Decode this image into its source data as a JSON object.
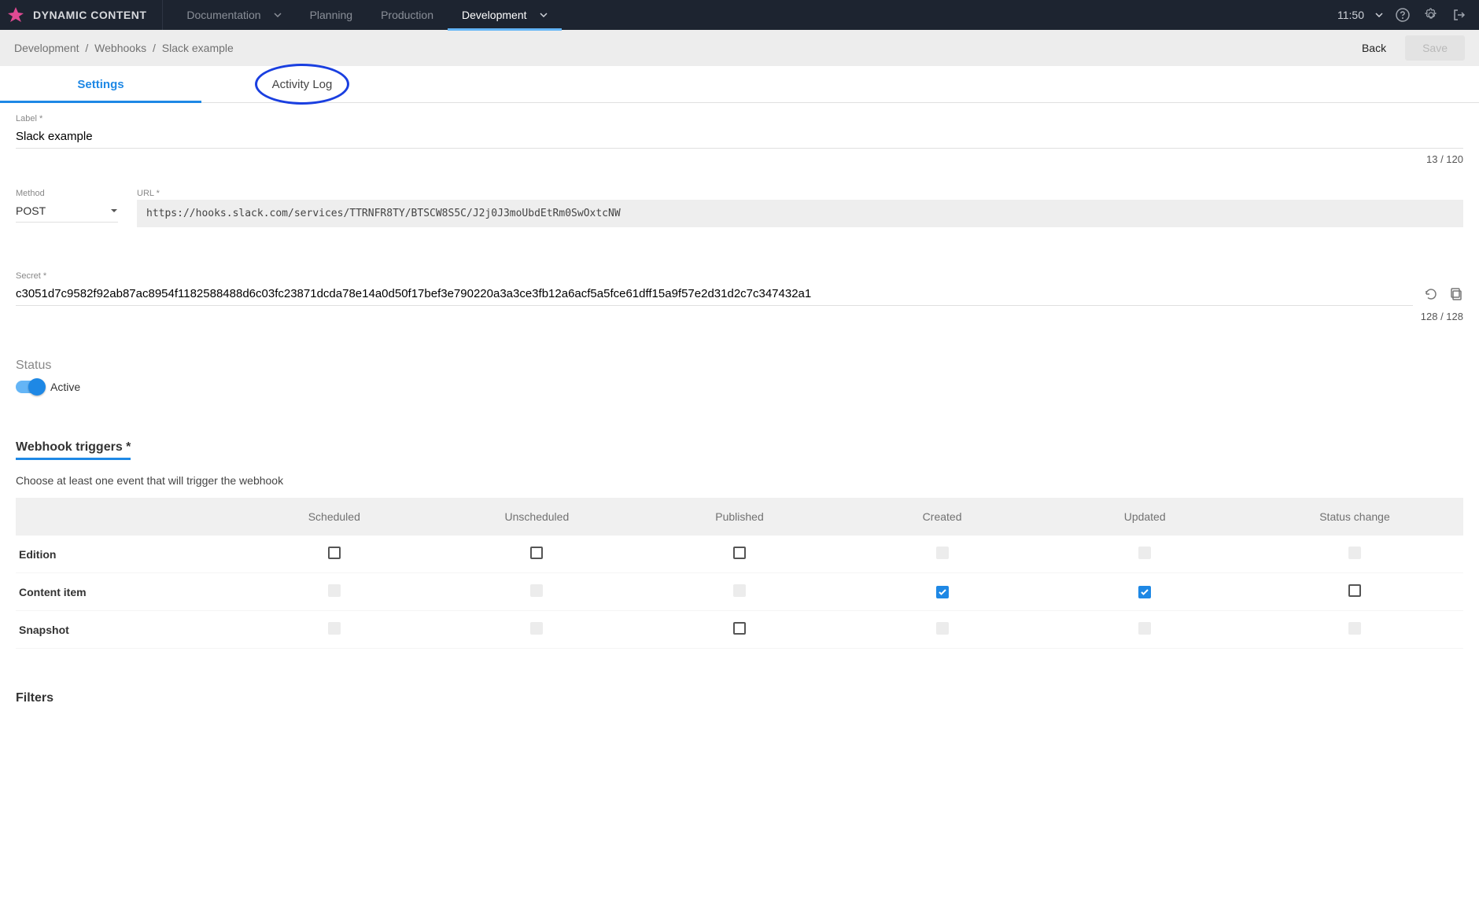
{
  "brand": "DYNAMIC CONTENT",
  "nav": {
    "documentation": "Documentation",
    "planning": "Planning",
    "production": "Production",
    "development": "Development"
  },
  "time": "11:50",
  "breadcrumb": {
    "dev": "Development",
    "webhooks": "Webhooks",
    "current": "Slack example"
  },
  "actions": {
    "back": "Back",
    "save": "Save"
  },
  "tabs": {
    "settings": "Settings",
    "activity": "Activity Log"
  },
  "form": {
    "label_label": "Label *",
    "label_value": "Slack example",
    "label_count": "13 / 120",
    "method_label": "Method",
    "method_value": "POST",
    "url_label": "URL *",
    "url_value": "https://hooks.slack.com/services/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",
    "secret_label": "Secret *",
    "secret_value": "c3051d7c9582f92ab87ac8954f1182588488d6c03fc23871dcda78e14a0d50f17bef3e790220a3a3ce3fb12a6acf5a5fce61dff15a9f57e2d31d2c7c347432a1",
    "secret_count": "128 / 128"
  },
  "status": {
    "label": "Status",
    "value": "Active"
  },
  "triggers": {
    "title": "Webhook triggers *",
    "help": "Choose at least one event that will trigger the webhook",
    "cols": {
      "scheduled": "Scheduled",
      "unscheduled": "Unscheduled",
      "published": "Published",
      "created": "Created",
      "updated": "Updated",
      "status_change": "Status change"
    },
    "rows": {
      "edition": "Edition",
      "content_item": "Content item",
      "snapshot": "Snapshot"
    }
  },
  "filters": {
    "title": "Filters"
  }
}
